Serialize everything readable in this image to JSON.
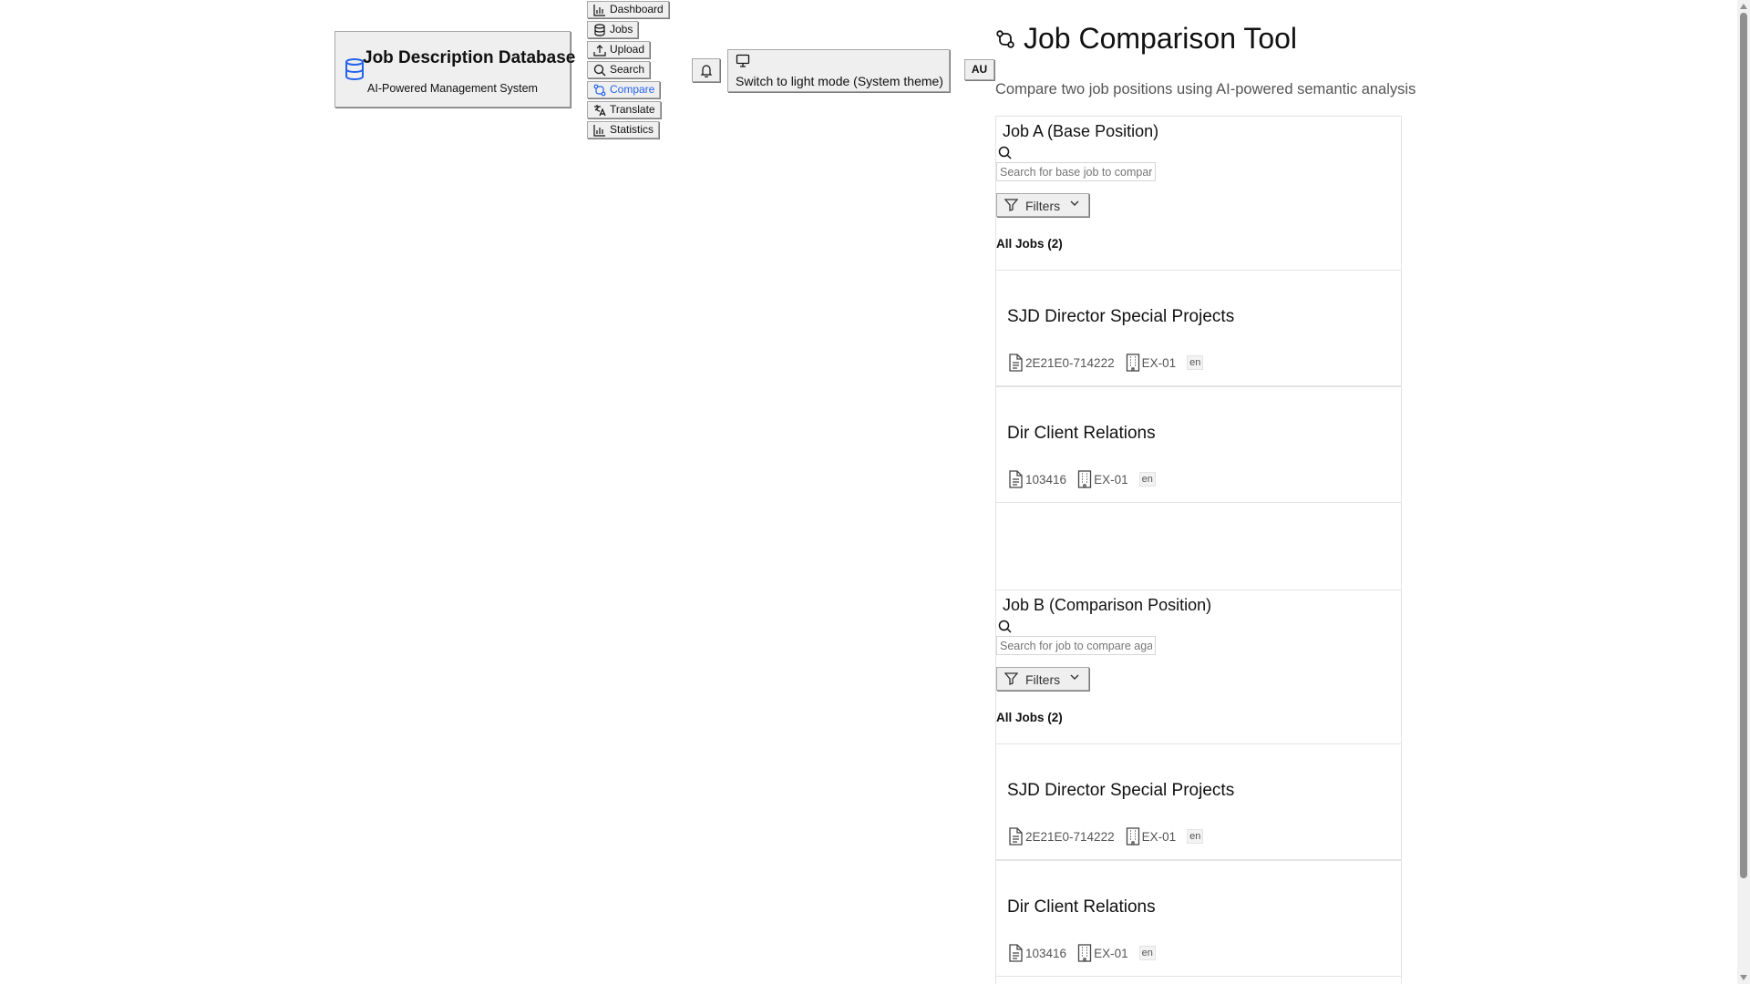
{
  "brand": {
    "title": "Job Description Database",
    "subtitle": "AI-Powered Management System",
    "icon": "database-icon"
  },
  "nav": {
    "items": [
      {
        "label": "Dashboard",
        "icon": "bar-chart-icon",
        "active": false
      },
      {
        "label": "Jobs",
        "icon": "database-icon",
        "active": false
      },
      {
        "label": "Upload",
        "icon": "upload-icon",
        "active": false
      },
      {
        "label": "Search",
        "icon": "search-icon",
        "active": false
      },
      {
        "label": "Compare",
        "icon": "git-compare-icon",
        "active": true
      },
      {
        "label": "Translate",
        "icon": "languages-icon",
        "active": false
      },
      {
        "label": "Statistics",
        "icon": "bar-chart-icon",
        "active": false
      }
    ]
  },
  "header": {
    "theme_button": "Switch to light mode (System theme)",
    "user_initials": "AU"
  },
  "page": {
    "title": "Job Comparison Tool",
    "description": "Compare two job positions using AI-powered semantic analysis"
  },
  "colors": {
    "accent": "#2563eb",
    "button_bg": "#efefef",
    "muted_text": "#555555"
  },
  "panels": [
    {
      "title": "Job A (Base Position)",
      "search_placeholder": "Search for base job to compare",
      "filters_label": "Filters",
      "all_jobs_label": "All Jobs (2)",
      "jobs": [
        {
          "title": "SJD Director Special Projects",
          "id": "2E21E0-714222",
          "classification": "EX-01",
          "lang": "en"
        },
        {
          "title": "Dir Client Relations",
          "id": "103416",
          "classification": "EX-01",
          "lang": "en"
        }
      ]
    },
    {
      "title": "Job B (Comparison Position)",
      "search_placeholder": "Search for job to compare against",
      "filters_label": "Filters",
      "all_jobs_label": "All Jobs (2)",
      "jobs": [
        {
          "title": "SJD Director Special Projects",
          "id": "2E21E0-714222",
          "classification": "EX-01",
          "lang": "en"
        },
        {
          "title": "Dir Client Relations",
          "id": "103416",
          "classification": "EX-01",
          "lang": "en"
        }
      ]
    }
  ]
}
